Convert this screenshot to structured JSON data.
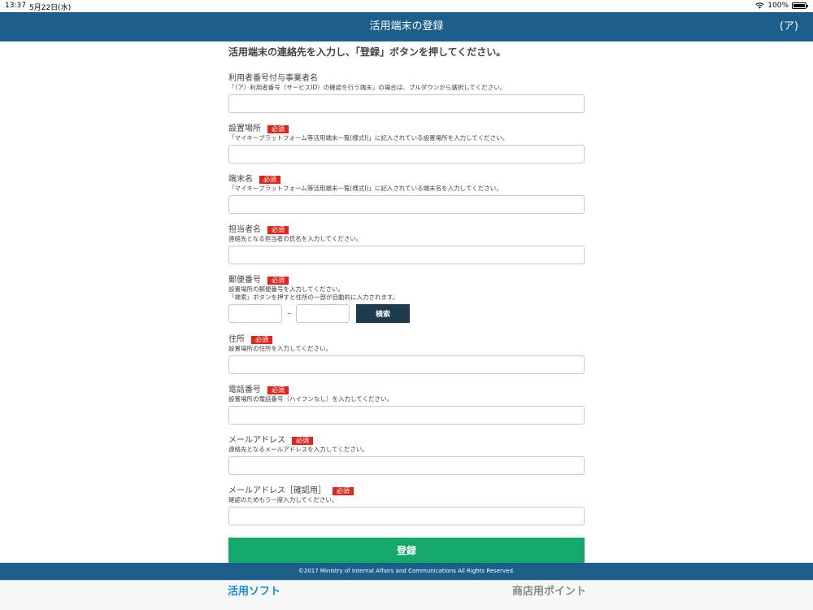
{
  "status_bar": {
    "time": "13:37",
    "date": "5月22日(水)",
    "battery": "100%"
  },
  "header": {
    "title": "活用端末の登録",
    "right_label": "(ア)"
  },
  "form": {
    "instruction": "活用端末の連絡先を入力し、「登録」ボタンを押してください。",
    "required_badge": "必須",
    "fields": [
      {
        "label": "利用者番号付与事業者名",
        "required": false,
        "help": [
          "「（ア）利用者番号（サービスID）の確認を行う端末」の場合は、プルダウンから選択してください。"
        ]
      },
      {
        "label": "設置場所",
        "required": true,
        "help": [
          "「マイキープラットフォーム等活用端末一覧(様式Ⅰ)」に記入されている設置場所を入力してください。"
        ]
      },
      {
        "label": "端末名",
        "required": true,
        "help": [
          "「マイキープラットフォーム等活用端末一覧(様式Ⅰ)」に記入されている端末名を入力してください。"
        ]
      },
      {
        "label": "担当者名",
        "required": true,
        "help": [
          "連絡先となる担当者の氏名を入力してください。"
        ]
      },
      {
        "label": "郵便番号",
        "required": true,
        "help": [
          "設置場所の郵便番号を入力してください。",
          "「検索」ボタンを押すと住所の一部が自動的に入力されます。"
        ],
        "separator": "–",
        "search_label": "検索"
      },
      {
        "label": "住所",
        "required": true,
        "help": [
          "設置場所の住所を入力してください。"
        ]
      },
      {
        "label": "電話番号",
        "required": true,
        "help": [
          "設置場所の電話番号（ハイフンなし）を入力してください。"
        ]
      },
      {
        "label": "メールアドレス",
        "required": true,
        "help": [
          "連絡先となるメールアドレスを入力してください。"
        ]
      },
      {
        "label": "メールアドレス［確認用］",
        "required": true,
        "help": [
          "確認のためもう一度入力してください。"
        ]
      }
    ],
    "register_label": "登録"
  },
  "footer": {
    "copyright": "©2017 Ministry of Internal Affairs and Communications All Rights Reserved."
  },
  "tabbar": {
    "active": "活用ソフト",
    "inactive": "商店用ポイント"
  },
  "colors": {
    "header": "#1d5f8a",
    "required": "#e3241b",
    "register": "#14a86b",
    "search": "#1d3a4e",
    "active_tab": "#1b8ad8"
  }
}
